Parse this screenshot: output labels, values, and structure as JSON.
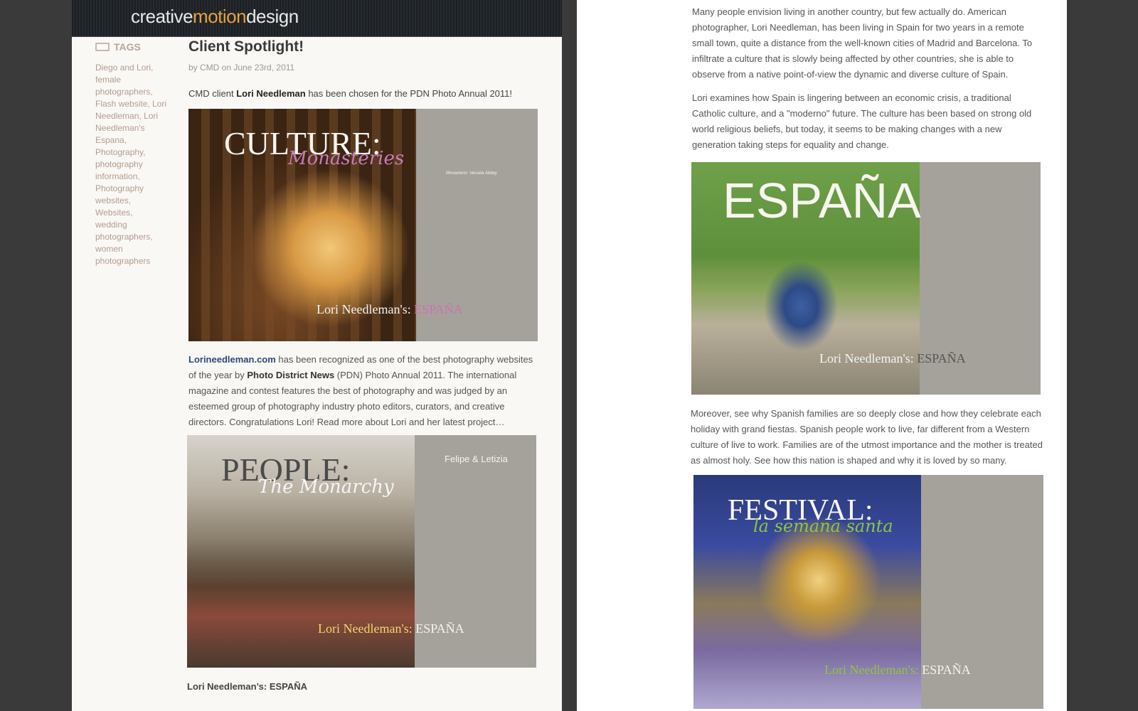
{
  "site": {
    "logo_left": "creative",
    "logo_mid": "motion",
    "logo_right": "design"
  },
  "sidebar": {
    "heading": "TAGS",
    "tags": [
      "Diego and Lori,",
      "female",
      "photographers,",
      "Flash website,",
      "Lori",
      "Needleman,",
      "Lori",
      "Needleman's",
      "Espana,",
      "Photography,",
      "photography",
      "information,",
      "Photography",
      "websites,",
      "Websites,",
      "wedding",
      "photographers,",
      "women",
      "photographers"
    ]
  },
  "post": {
    "title": "Client Spotlight!",
    "meta": "by CMD on June 23rd, 2011",
    "intro_a": "CMD client ",
    "intro_name": "Lori Needleman",
    "intro_b": " has been chosen for the PDN Photo Annual 2011!",
    "body_link": "Lorineedleman.com",
    "body_a": " has been recognized as one of the best photography websites of the year by ",
    "body_bold": "Photo District News",
    "body_b": " (PDN) Photo Annual 2011. The international magazine and contest features the best of photography and was judged by an esteemed group of photography industry photo editors, curators, and creative directors. Congratulations Lori!  Read more about Lori and her latest project…",
    "caption": "Lori Needleman’s: ESPAÑA"
  },
  "spreads": {
    "culture": {
      "title": "CULTURE:",
      "script": "Monasteries",
      "byline_a": "Lori  Needleman's: ",
      "byline_b": "ESPAÑA",
      "side_heading": "Monasterio: Veruela Abbey"
    },
    "people": {
      "title": "PEOPLE:",
      "script": "The Monarchy",
      "byline_a": "Lori  Needleman's: ",
      "byline_b": "ESPAÑA",
      "side_heading": "Felipe & Letizia"
    },
    "espana": {
      "title": "ESPAÑA",
      "byline_a": "Lori  Needleman's: ",
      "byline_b": "ESPAÑA"
    },
    "festival": {
      "title": "FESTIVAL:",
      "script": "la semana santa",
      "byline_a": "Lori  Needleman's: ",
      "byline_b": "ESPAÑA"
    }
  },
  "right": {
    "p1": "Many people envision living in another country, but few actually do. American photographer, Lori Needleman, has been living in Spain for two years in a remote small town, quite a distance from the well-known cities of Madrid and Barcelona. To infiltrate a culture that is slowly being affected by other countries, she is able to observe from a native point-of-view the dynamic and diverse culture of Spain.",
    "p2": "Lori examines how Spain is lingering between an economic crisis, a traditional Catholic culture, and a \"moderno\" future. The culture has been based on strong old world religious beliefs, but today, it seems to be making changes with a new generation taking steps for equality and change.",
    "p3": "Moreover, see why Spanish families are so deeply close and how they celebrate each holiday with grand fiestas. Spanish people work to live, far different from a Western culture of live to work. Families are of the utmost importance and the mother is treated as almost holy. See how this nation is shaped and why it is loved by so many."
  },
  "colors": {
    "accent_orange": "#e6a23c",
    "accent_pink": "#c77bb8",
    "accent_green": "#8dc63f",
    "link_blue": "#2a4a7a"
  }
}
